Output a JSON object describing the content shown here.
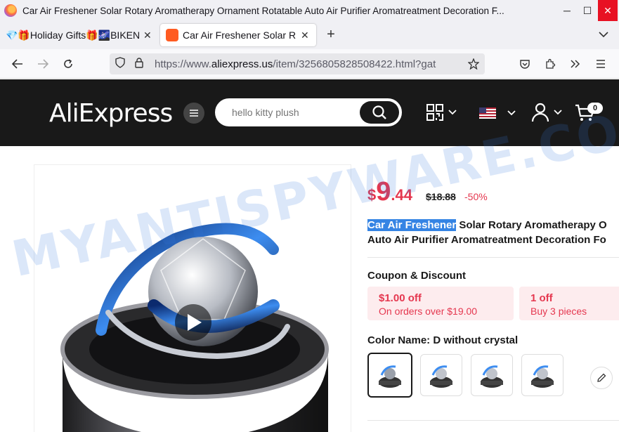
{
  "window": {
    "title": "Car Air Freshener Solar Rotary Aromatherapy Ornament Rotatable Auto Air Purifier Aromatreatment Decoration F...",
    "minimize": "─",
    "maximize": "☐",
    "close": "✕"
  },
  "tabs": [
    {
      "label": "💎🎁Holiday Gifts🎁🌌BIKEND",
      "active": false
    },
    {
      "label": "Car Air Freshener Solar R",
      "active": true
    }
  ],
  "new_tab": "+",
  "tab_list": "⌄",
  "url": {
    "prefix": "https://www.",
    "domain": "aliexpress.us",
    "path": "/item/3256805828508422.html?gat"
  },
  "site": {
    "logo": "AliExpress",
    "search_placeholder": "hello kitty plush",
    "cart_count": "0",
    "flag_colors": {
      "stripe": "#b22234",
      "canton": "#3c3b6e"
    }
  },
  "product": {
    "currency": "$",
    "price_int": "9",
    "price_dec": ".44",
    "original_price": "$18.88",
    "discount": "-50%",
    "title_highlight": "Car Air Freshener",
    "title_line1_rest": " Solar Rotary Aromatherapy O",
    "title_line2": "Auto Air Purifier Aromatreatment Decoration Fo",
    "coupon_label": "Coupon & Discount",
    "coupons": [
      {
        "title": "$1.00 off",
        "detail": "On orders over $19.00"
      },
      {
        "title": "1 off",
        "detail": "Buy 3 pieces"
      }
    ],
    "color_label": "Color Name: D without crystal"
  },
  "watermark": "MYANTISPYWARE.COM",
  "colors": {
    "accent_red": "#e5374f",
    "header_bg": "#191919",
    "highlight": "#3584e4"
  }
}
